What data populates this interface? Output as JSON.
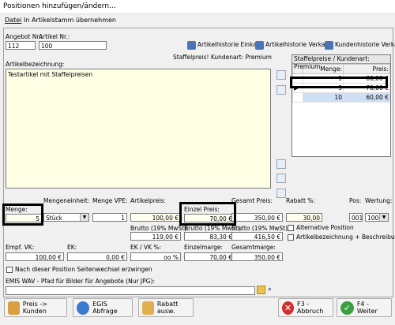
{
  "window": {
    "title": "Positionen hinzufügen/ändern..."
  },
  "menu": {
    "datei": "Datei",
    "artikelstamm": "In Artikelstamm übernehmen"
  },
  "header": {
    "angebot_label": "Angebot Nr.:",
    "angebot_value": "112",
    "artikel_label": "Artikel Nr.:",
    "artikel_value": "100",
    "btn_einkauf": "Artikelhistorie Einkauf",
    "btn_verkauf": "Artikelhistorie Verkauf",
    "btn_kunde": "Kundenhistorie Verkauf",
    "staffelpreis_info": "Staffelpreis! Kundenart: Premium"
  },
  "bezeichnung": {
    "label": "Artikelbezeichnung:",
    "text": "Testartikel mit Staffelpreisen"
  },
  "staffel": {
    "title": "Staffelpreise / Kundenart: Premium",
    "col_menge": "Menge:",
    "col_preis": "Preis:",
    "rows": [
      {
        "menge": "1",
        "preis": "80,00 €"
      },
      {
        "menge": "5",
        "preis": "70,00 €"
      },
      {
        "menge": "10",
        "preis": "60,00 €"
      }
    ]
  },
  "fields": {
    "menge_label": "Menge:",
    "menge_value": "5",
    "mengeneinheit_label": "Mengeneinheit:",
    "mengeneinheit_value": "Stück",
    "menge_vpe_label": "Menge VPE:",
    "menge_vpe_value": "1",
    "artikelpreis_label": "Artikelpreis:",
    "artikelpreis_value": "100,00 €",
    "einzelpreis_label": "Einzel Preis:",
    "einzelpreis_value": "70,00 €",
    "gesamtpreis_label": "Gesamt Preis:",
    "gesamtpreis_value": "350,00 €",
    "rabatt_label": "Rabatt %:",
    "rabatt_value": "30,00",
    "pos_label": "Pos:",
    "pos_value": "001",
    "wertung_label": "Wertung:",
    "wertung_value": "100",
    "brutto_label": "Brutto (19% MwSt):",
    "brutto1_value": "119,00 €",
    "brutto2_value": "83,30 €",
    "brutto3_value": "416,50 €",
    "alt_position": "Alternative Position",
    "artbez_beschreibung": "Artikelbezeichnung + Beschreibung",
    "empf_vk_label": "Empf. VK:",
    "empf_vk_value": "100,00 €",
    "ek_label": "EK:",
    "ek_value": "0,00 €",
    "ek_vk_label": "EK / VK %:",
    "ek_vk_value": "oo %",
    "einzelmarge_label": "Einzelmarge:",
    "einzelmarge_value": "70,00 €",
    "gesamtmarge_label": "Gesamtmarge:",
    "gesamtmarge_value": "350,00 €",
    "seitenwechsel": "Nach dieser Position Seitenwechsel erzwingen",
    "emis_label": "EMIS WAV - Pfad für Bilder für Angebote (Nur JPG):",
    "emis_value": ""
  },
  "buttons": {
    "preis_kunden": "Preis -> Kunden",
    "egis": "EGIS Abfrage",
    "rabatt": "Rabatt ausw.",
    "abbruch": "F3 - Abbruch",
    "weiter": "F4 - Weiter"
  }
}
